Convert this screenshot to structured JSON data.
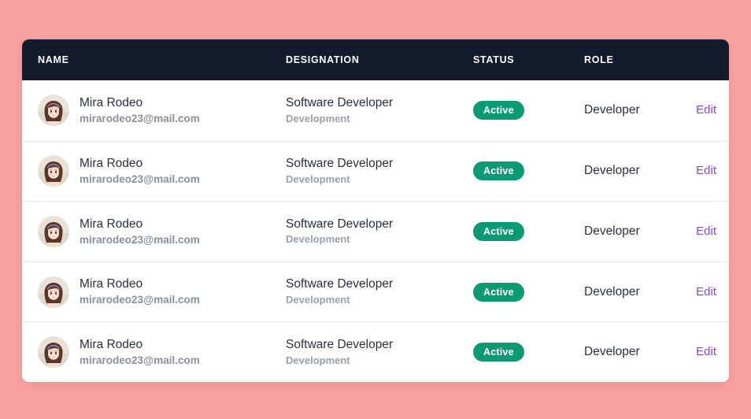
{
  "theme": {
    "page_background": "#f9a2a2",
    "card_background": "#ffffff",
    "header_background": "#141b2d",
    "badge_color": "#0b9b72",
    "link_color": "#7f4ae0",
    "row_divider": "#e9e9ed"
  },
  "table": {
    "columns": [
      {
        "key": "name",
        "label": "NAME"
      },
      {
        "key": "designation",
        "label": "DESIGNATION"
      },
      {
        "key": "status",
        "label": "STATUS"
      },
      {
        "key": "role",
        "label": "ROLE"
      },
      {
        "key": "action",
        "label": ""
      }
    ],
    "rows": [
      {
        "avatar": "avatar-mira-rodeo",
        "name": "Mira Rodeo",
        "email": "mirarodeo23@mail.com",
        "designation": "Software Developer",
        "department": "Development",
        "status": "Active",
        "role": "Developer",
        "action": "Edit"
      },
      {
        "avatar": "avatar-mira-rodeo",
        "name": "Mira Rodeo",
        "email": "mirarodeo23@mail.com",
        "designation": "Software Developer",
        "department": "Development",
        "status": "Active",
        "role": "Developer",
        "action": "Edit"
      },
      {
        "avatar": "avatar-mira-rodeo",
        "name": "Mira Rodeo",
        "email": "mirarodeo23@mail.com",
        "designation": "Software Developer",
        "department": "Development",
        "status": "Active",
        "role": "Developer",
        "action": "Edit"
      },
      {
        "avatar": "avatar-mira-rodeo",
        "name": "Mira Rodeo",
        "email": "mirarodeo23@mail.com",
        "designation": "Software Developer",
        "department": "Development",
        "status": "Active",
        "role": "Developer",
        "action": "Edit"
      },
      {
        "avatar": "avatar-mira-rodeo",
        "name": "Mira Rodeo",
        "email": "mirarodeo23@mail.com",
        "designation": "Software Developer",
        "department": "Development",
        "status": "Active",
        "role": "Developer",
        "action": "Edit"
      }
    ]
  }
}
